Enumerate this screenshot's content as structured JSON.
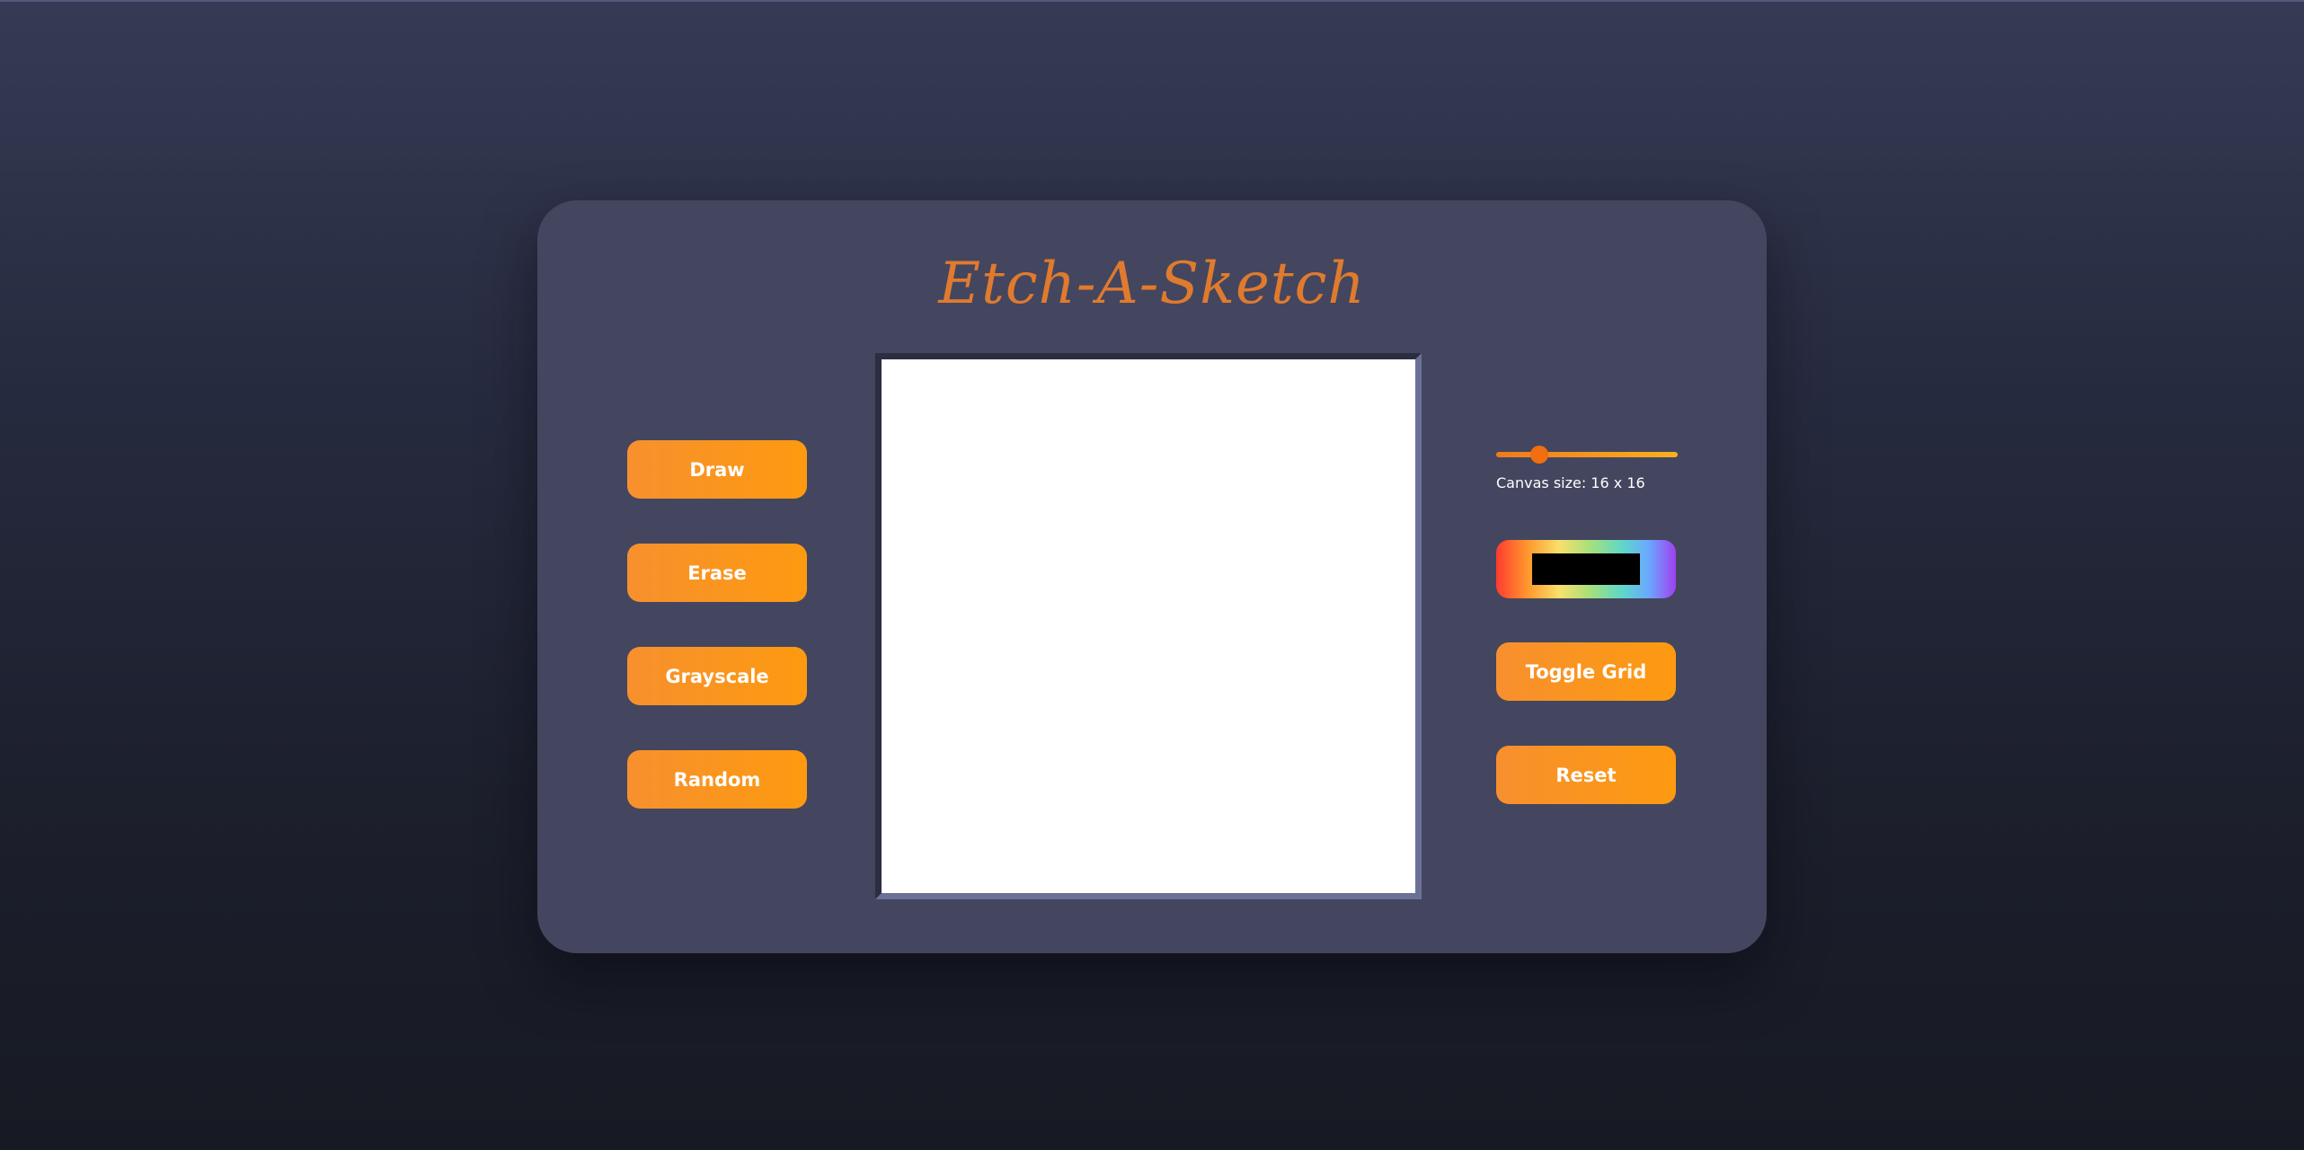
{
  "app": {
    "title": "Etch-A-Sketch"
  },
  "left_controls": {
    "draw_label": "Draw",
    "erase_label": "Erase",
    "grayscale_label": "Grayscale",
    "random_label": "Random"
  },
  "right_controls": {
    "canvas_size_slider": {
      "min": 1,
      "max": 100,
      "value": 16
    },
    "canvas_size_label": "Canvas size: 16 x 16",
    "color_picker": {
      "value": "#000000"
    },
    "toggle_grid_label": "Toggle Grid",
    "reset_label": "Reset"
  },
  "colors": {
    "accent": "#fd9a10",
    "title": "#e07a2e",
    "panel": "#43465e",
    "canvas": "#ffffff"
  }
}
